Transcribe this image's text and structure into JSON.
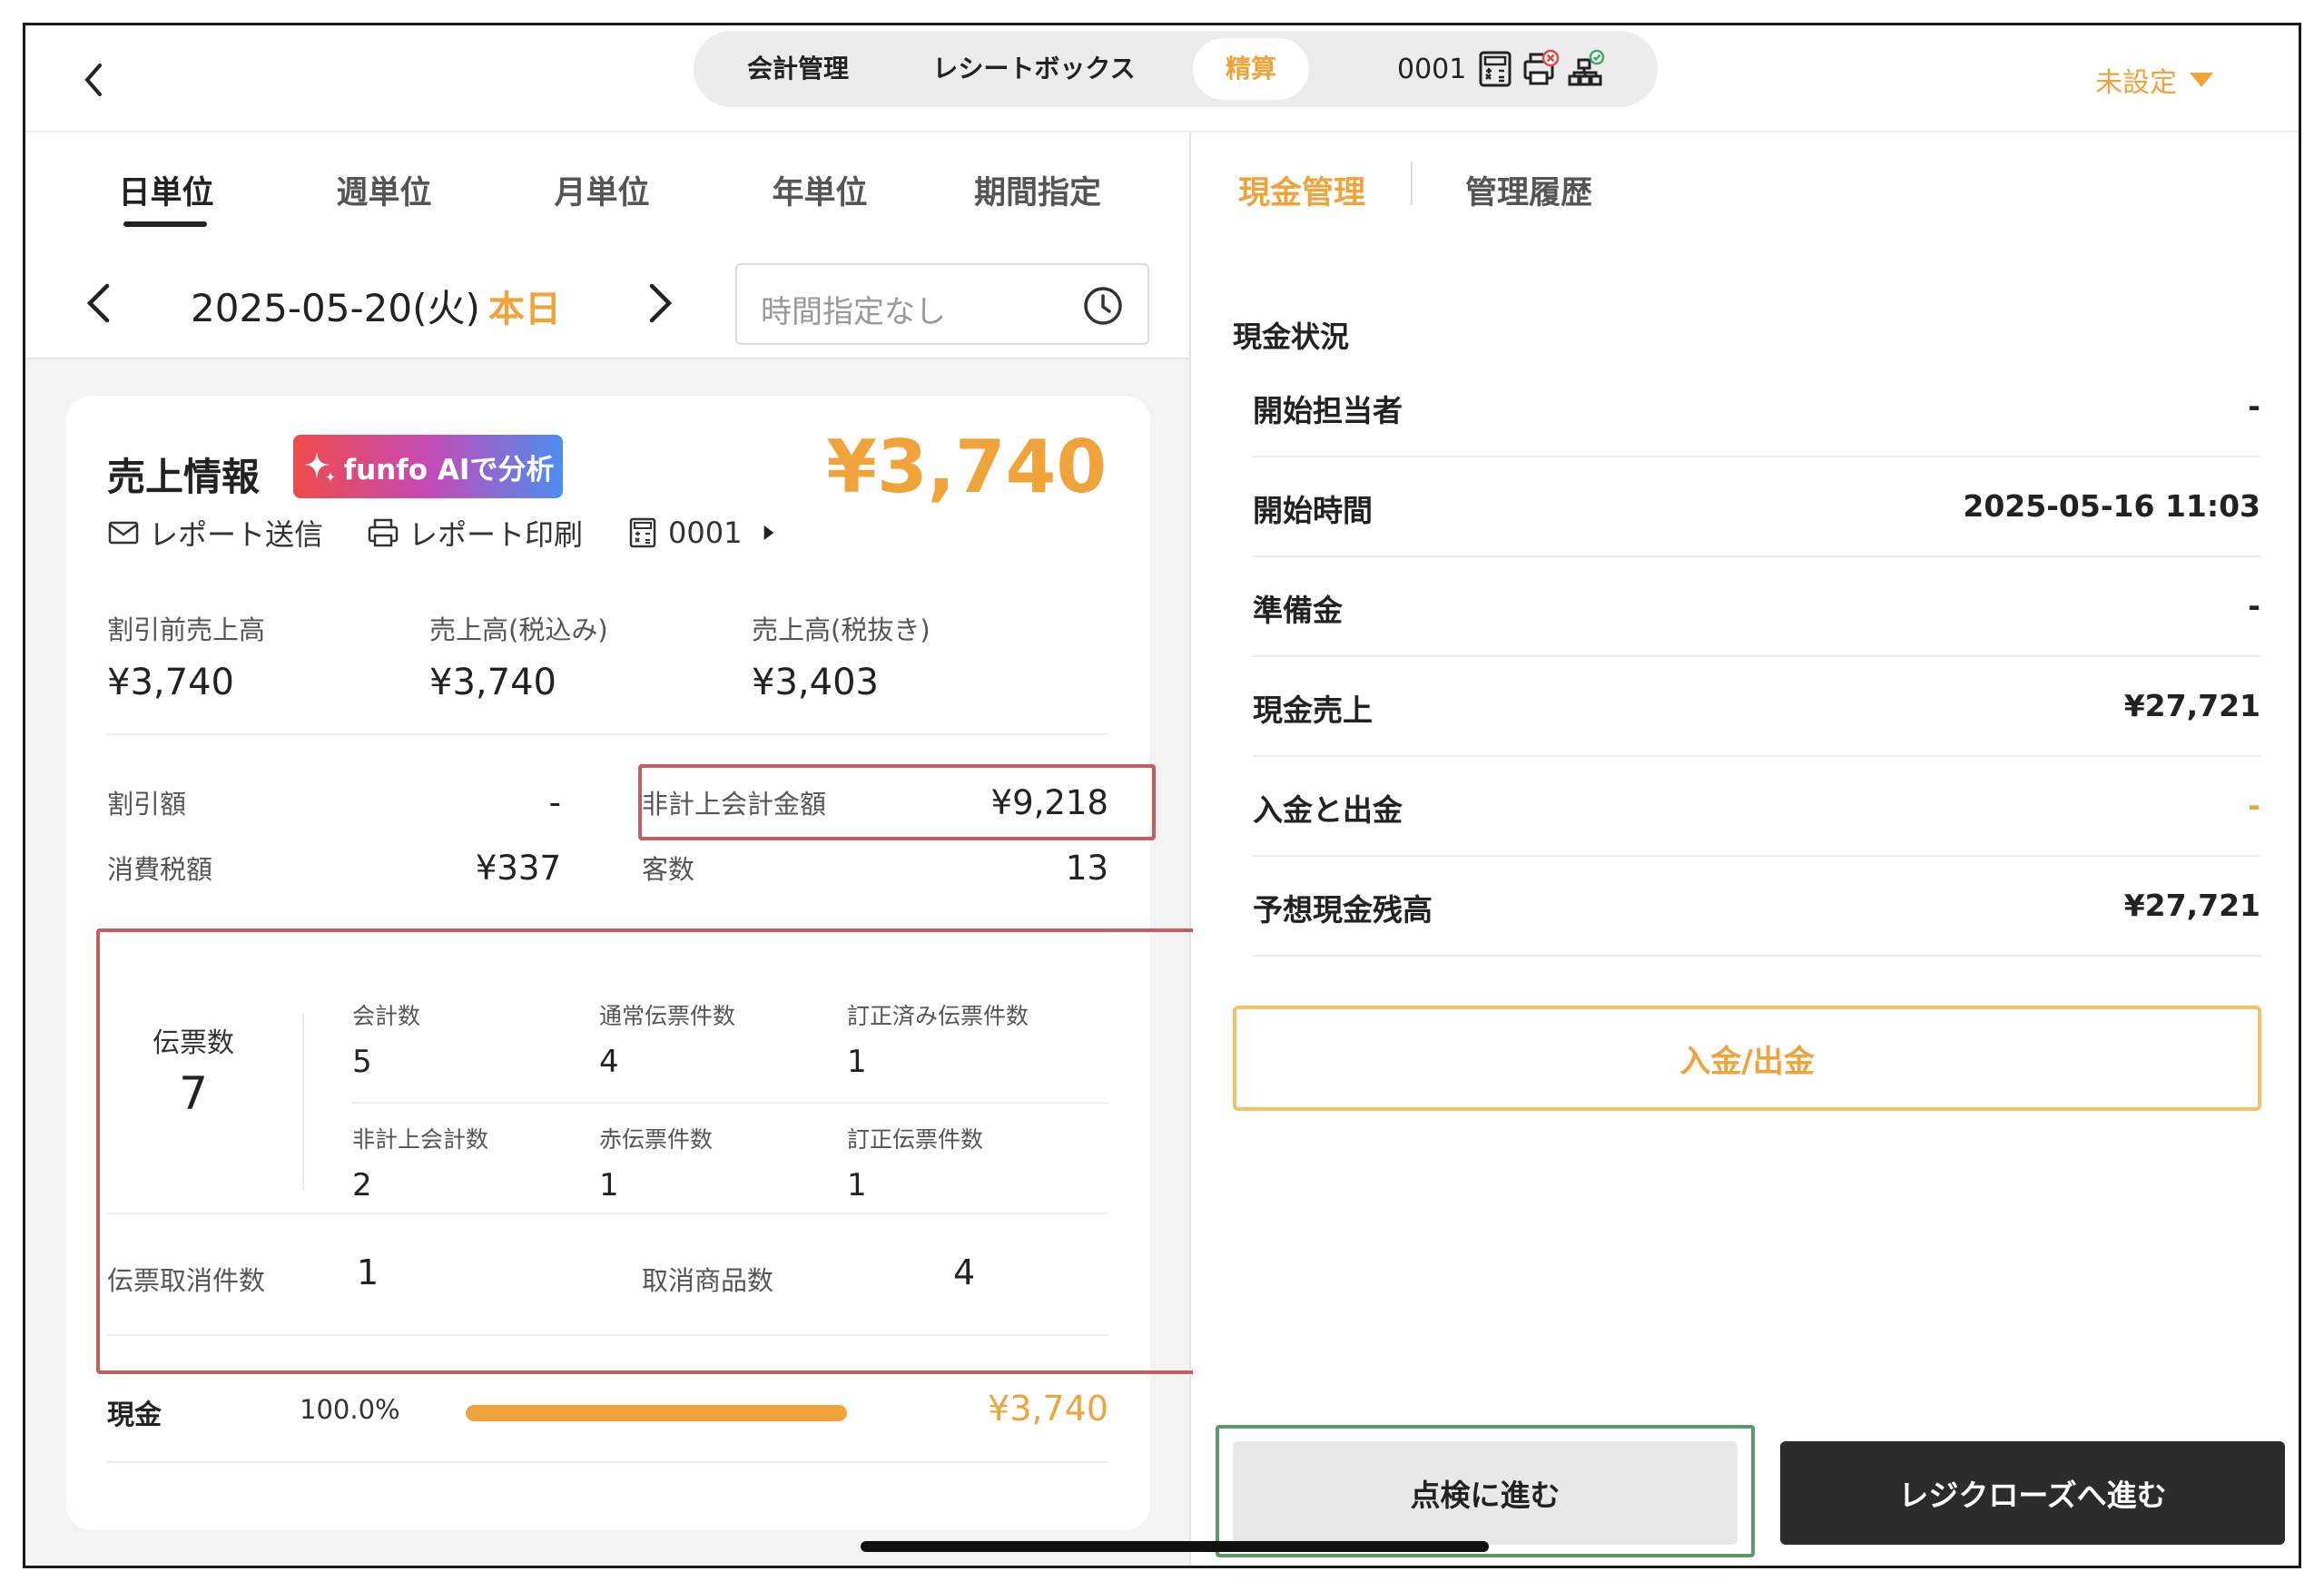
{
  "topbar": {
    "segments": [
      "会計管理",
      "レシートボックス",
      "精算"
    ],
    "active_segment": "精算",
    "register_number": "0001",
    "register_icons": [
      "calculator-icon",
      "printer-error-icon",
      "network-ok-icon"
    ],
    "unset_label": "未設定",
    "accent_color": "#f0a23b"
  },
  "period_tabs": [
    "日単位",
    "週単位",
    "月単位",
    "年単位",
    "期間指定"
  ],
  "active_period_tab": "日単位",
  "date": {
    "text": "2025-05-20(火)",
    "today_label": "本日",
    "time_placeholder": "時間指定なし"
  },
  "sales": {
    "title": "売上情報",
    "ai_button": "funfo AIで分析",
    "total": "¥3,740",
    "actions": {
      "send": "レポート送信",
      "print": "レポート印刷",
      "register": "0001"
    },
    "stats": [
      {
        "label": "割引前売上高",
        "value": "¥3,740"
      },
      {
        "label": "売上高(税込み)",
        "value": "¥3,740"
      },
      {
        "label": "売上高(税抜き)",
        "value": "¥3,403"
      }
    ],
    "discount": {
      "label": "割引額",
      "value": "-"
    },
    "tax": {
      "label": "消費税額",
      "value": "¥337"
    },
    "non_recorded": {
      "label": "非計上会計金額",
      "value": "¥9,218"
    },
    "customers": {
      "label": "客数",
      "value": "13"
    }
  },
  "slips": {
    "label": "伝票数",
    "total": "7",
    "grid": [
      {
        "label": "会計数",
        "value": "5"
      },
      {
        "label": "通常伝票件数",
        "value": "4"
      },
      {
        "label": "訂正済み伝票件数",
        "value": "1"
      },
      {
        "label": "非計上会計数",
        "value": "2"
      },
      {
        "label": "赤伝票件数",
        "value": "1"
      },
      {
        "label": "訂正伝票件数",
        "value": "1"
      }
    ],
    "cancel_slips": {
      "label": "伝票取消件数",
      "value": "1"
    },
    "cancel_items": {
      "label": "取消商品数",
      "value": "4"
    }
  },
  "payment": {
    "name": "現金",
    "percent": "100.0%",
    "fill_fraction": 1.0,
    "amount": "¥3,740"
  },
  "right": {
    "tabs": [
      "現金管理",
      "管理履歴"
    ],
    "active_tab": "現金管理",
    "status_title": "現金状況",
    "rows": [
      {
        "label": "開始担当者",
        "value": "-"
      },
      {
        "label": "開始時間",
        "value": "2025-05-16 11:03"
      },
      {
        "label": "準備金",
        "value": "-"
      },
      {
        "label": "現金売上",
        "value": "¥27,721"
      },
      {
        "label": "入金と出金",
        "value": "-"
      },
      {
        "label": "予想現金残高",
        "value": "¥27,721"
      }
    ],
    "deposit_button": "入金/出金",
    "inspect_button": "点検に進む",
    "close_button": "レジクローズへ進む"
  }
}
